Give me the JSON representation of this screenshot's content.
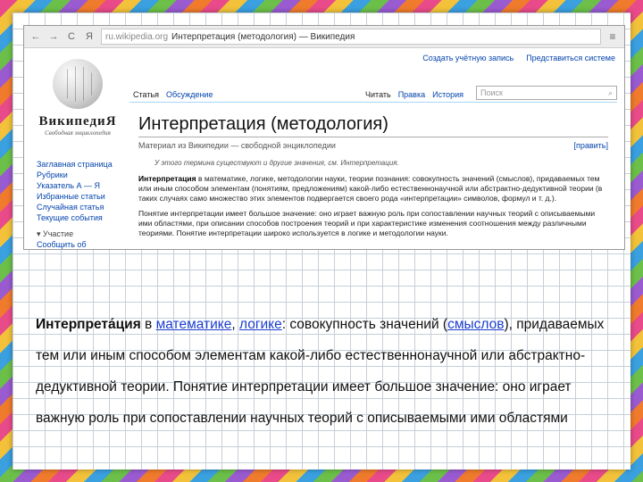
{
  "browser": {
    "back_glyph": "←",
    "forward_glyph": "→",
    "reload_glyph": "C",
    "ya_glyph": "Я",
    "url": "ru.wikipedia.org",
    "title": "Интерпретация (методология) — Википедия",
    "menu_glyph": "≡"
  },
  "personal": {
    "create_account": "Создать учётную запись",
    "login": "Представиться системе"
  },
  "logo": {
    "wordmark": "ВикипедиЯ",
    "tagline": "Свободная энциклопедия"
  },
  "sidebar": {
    "items": [
      "Заглавная страница",
      "Рубрики",
      "Указатель А — Я",
      "Избранные статьи",
      "Случайная статья",
      "Текущие события"
    ],
    "section": "▾ Участие",
    "section_item": "Сообщить об"
  },
  "tabs": {
    "article": "Статья",
    "discussion": "Обсуждение",
    "read": "Читать",
    "edit": "Правка",
    "history": "История",
    "search_placeholder": "Поиск",
    "search_icon": "⌕"
  },
  "article": {
    "title": "Интерпретация (методология)",
    "from": "Материал из Википедии — свободной энциклопедии",
    "edit_link": "[править]",
    "hatnote": "У этого термина существуют и другие значения, см. Интерпретация.",
    "p1_bold": "Интерпретация",
    "p1": " в математике, логике, методологии науки, теории познания: совокупность значений (смыслов), придаваемых тем или иным способом элементам (понятиям, предложениям) какой-либо естественнонаучной или абстрактно-дедуктивной теории (в таких случаях само множество этих элементов подвергается своего рода «интерпретации» символов, формул и т. д.).",
    "p2": "Понятие интерпретации имеет большое значение: оно играет важную роль при сопоставлении научных теорий с описываемыми ими областями, при описании способов построения теорий и при характеристике изменения соотношения между различными теориями. Понятие интерпретации широко используется в логике и методологии науки."
  },
  "overlay": {
    "bold": "Интерпрета́ция",
    "t1": " в ",
    "link1": "математике",
    "t2": ", ",
    "link2": "логике",
    "t3": ": совокупность значений (",
    "link3": "смыслов",
    "t4": "), придаваемых тем или иным способом элементам какой-либо естественнонаучной или абстрактно-дедуктивной теории. Понятие интерпретации имеет большое значение: оно играет важную роль при сопоставлении научных теорий с описываемыми ими областями"
  },
  "colors": {
    "link": "#0645ad",
    "grid": "#c7cfd9"
  }
}
